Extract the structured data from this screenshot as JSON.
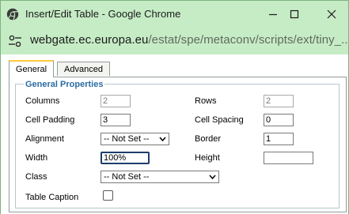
{
  "window": {
    "title": "Insert/Edit Table - Google Chrome",
    "controls": {
      "minimize": "minimize",
      "maximize": "maximize",
      "close": "close"
    }
  },
  "address": {
    "host": "webgate.ec.europa.eu",
    "path": "/estat/spe/metaconv/scripts/ext/tiny_..."
  },
  "tabs": [
    {
      "label": "General",
      "active": true
    },
    {
      "label": "Advanced",
      "active": false
    }
  ],
  "general": {
    "legend": "General Properties",
    "columns": {
      "label": "Columns",
      "value": "2"
    },
    "rows": {
      "label": "Rows",
      "value": "2"
    },
    "cell_padding": {
      "label": "Cell Padding",
      "value": "3"
    },
    "cell_spacing": {
      "label": "Cell Spacing",
      "value": "0"
    },
    "alignment": {
      "label": "Alignment",
      "value": "-- Not Set --"
    },
    "border": {
      "label": "Border",
      "value": "1"
    },
    "width": {
      "label": "Width",
      "value": "100%"
    },
    "height": {
      "label": "Height",
      "value": ""
    },
    "class": {
      "label": "Class",
      "value": "-- Not Set --"
    },
    "table_caption": {
      "label": "Table Caption",
      "checked": false
    }
  },
  "colors": {
    "titlebar": "#c6ecc6",
    "legend": "#2b6ca3",
    "active_tab_accent": "#ffc83c"
  }
}
